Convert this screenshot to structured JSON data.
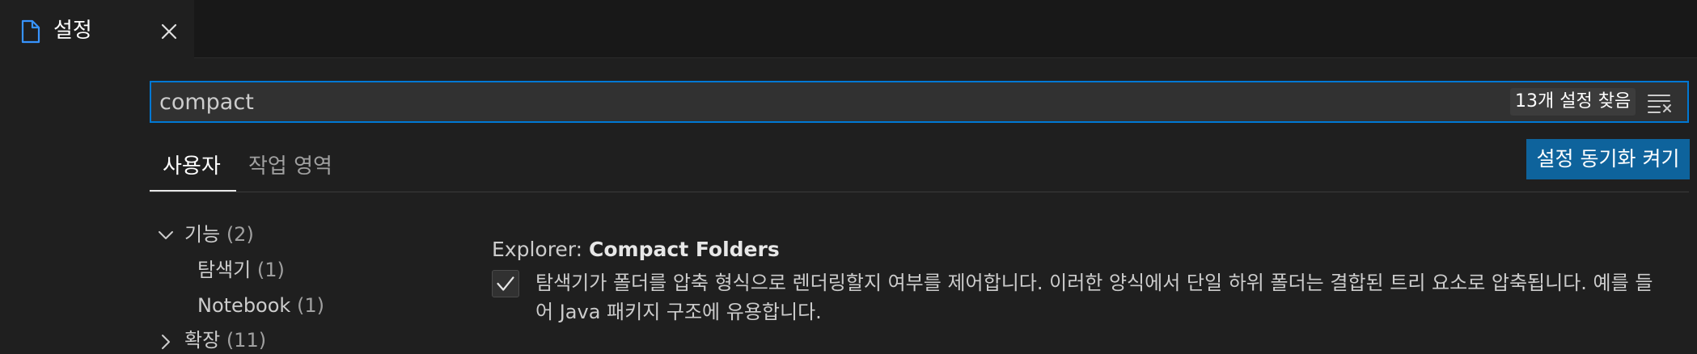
{
  "editor_tab": {
    "label": "설정",
    "icon": "file-icon",
    "close_icon": "close-icon"
  },
  "search": {
    "value": "compact",
    "result_count": "13개 설정 찾음",
    "clear_icon": "clear-filter-icon"
  },
  "scope_tabs": [
    {
      "label": "사용자",
      "active": true
    },
    {
      "label": "작업 영역",
      "active": false
    }
  ],
  "sync_button": {
    "label": "설정 동기화 켜기"
  },
  "toc": [
    {
      "label": "기능",
      "count": "(2)",
      "expanded": true
    },
    {
      "label": "탐색기",
      "count": "(1)"
    },
    {
      "label": "Notebook",
      "count": "(1)"
    },
    {
      "label": "확장",
      "count": "(11)",
      "expanded": false
    }
  ],
  "setting": {
    "category": "Explorer: ",
    "name": "Compact Folders",
    "checked": true,
    "description": "탐색기가 폴더를 압축 형식으로 렌더링할지 여부를 제어합니다. 이러한 양식에서 단일 하위 폴더는 결합된 트리 요소로 압축됩니다. 예를 들어 Java 패키지 구조에 유용합니다."
  },
  "colors": {
    "accent": "#0078d4",
    "button": "#0e639c",
    "tab_icon": "#3794ff",
    "background": "#1f1f1f"
  }
}
